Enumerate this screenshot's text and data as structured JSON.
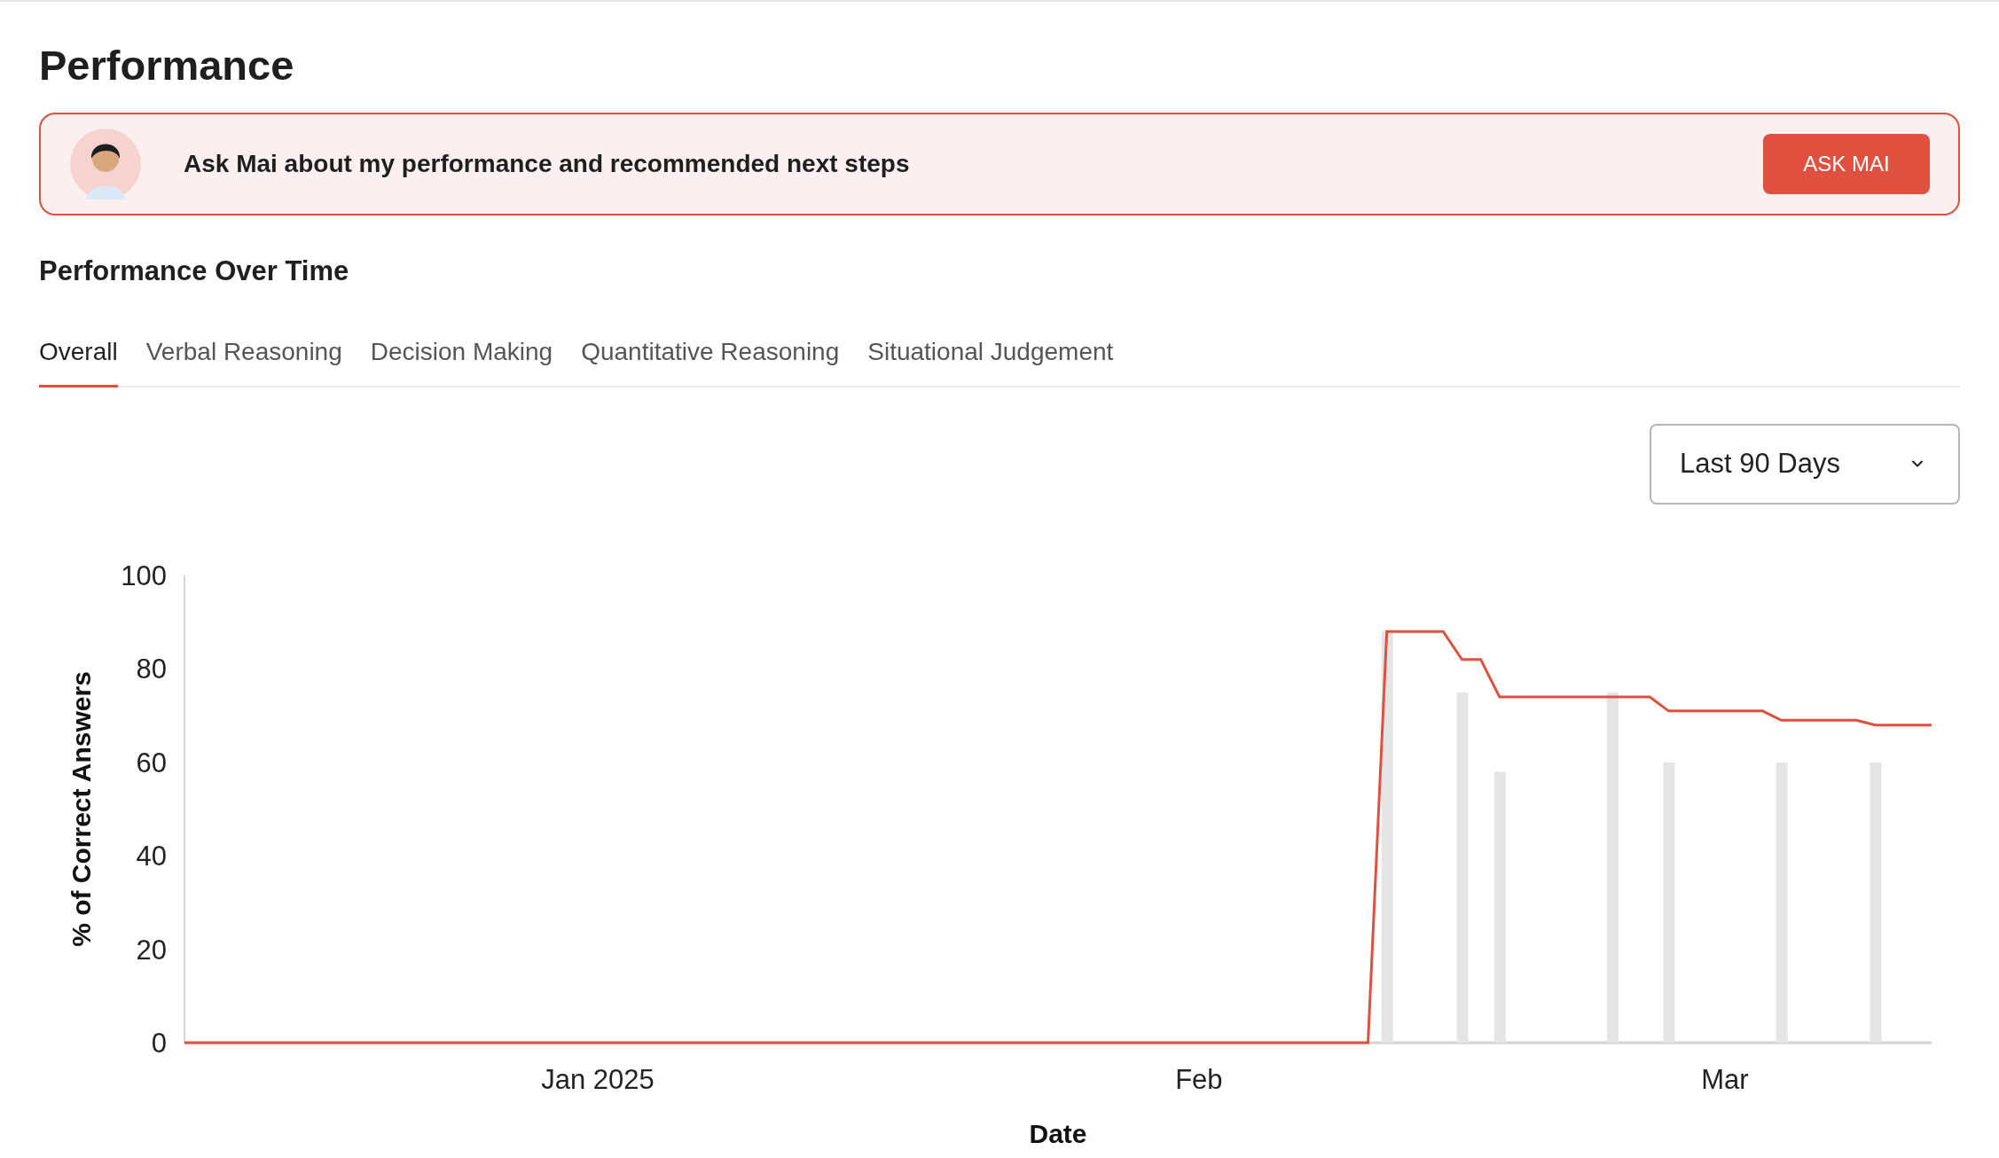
{
  "page": {
    "title": "Performance"
  },
  "banner": {
    "text": "Ask Mai about my performance and recommended next steps",
    "button": "ASK MAI"
  },
  "section": {
    "title": "Performance Over Time"
  },
  "tabs": [
    {
      "label": "Overall",
      "selected": true
    },
    {
      "label": "Verbal Reasoning",
      "selected": false
    },
    {
      "label": "Decision Making",
      "selected": false
    },
    {
      "label": "Quantitative Reasoning",
      "selected": false
    },
    {
      "label": "Situational Judgement",
      "selected": false
    }
  ],
  "range_select": {
    "value": "Last 90 Days"
  },
  "chart": {
    "chart_data": {
      "type": "line",
      "xlabel": "Date",
      "ylabel": "% of Correct Answers",
      "categories": [
        null,
        null,
        null,
        null,
        null,
        null,
        null,
        null,
        null,
        null,
        null,
        null,
        null,
        null,
        null,
        null,
        null,
        null,
        null,
        null,
        null,
        null,
        "Jan 2025",
        null,
        null,
        null,
        null,
        null,
        null,
        null,
        null,
        null,
        null,
        null,
        null,
        null,
        null,
        null,
        null,
        null,
        null,
        null,
        null,
        null,
        null,
        null,
        null,
        null,
        null,
        null,
        null,
        null,
        null,
        null,
        "Feb",
        null,
        null,
        null,
        null,
        null,
        null,
        null,
        null,
        null,
        null,
        null,
        null,
        null,
        null,
        null,
        null,
        null,
        null,
        null,
        null,
        null,
        null,
        null,
        null,
        null,
        null,
        null,
        "Mar",
        null,
        null,
        null,
        null,
        null,
        null,
        null,
        null,
        null,
        null,
        null
      ],
      "ylim": [
        0,
        100
      ],
      "yticks": [
        0,
        20,
        40,
        60,
        80,
        100
      ],
      "series": [
        {
          "type": "bar",
          "color": "#e5e5e5",
          "values": [
            null,
            null,
            null,
            null,
            null,
            null,
            null,
            null,
            null,
            null,
            null,
            null,
            null,
            null,
            null,
            null,
            null,
            null,
            null,
            null,
            null,
            null,
            null,
            null,
            null,
            null,
            null,
            null,
            null,
            null,
            null,
            null,
            null,
            null,
            null,
            null,
            null,
            null,
            null,
            null,
            null,
            null,
            null,
            null,
            null,
            null,
            null,
            null,
            null,
            null,
            null,
            null,
            null,
            null,
            null,
            null,
            null,
            null,
            null,
            null,
            null,
            null,
            null,
            null,
            88,
            null,
            null,
            null,
            75,
            null,
            58,
            null,
            null,
            null,
            null,
            null,
            75,
            null,
            null,
            60,
            null,
            null,
            null,
            null,
            null,
            60,
            null,
            null,
            null,
            null,
            60,
            null,
            null,
            null
          ]
        },
        {
          "color": "#e0503e",
          "values": [
            0,
            0,
            0,
            0,
            0,
            0,
            0,
            0,
            0,
            0,
            0,
            0,
            0,
            0,
            0,
            0,
            0,
            0,
            0,
            0,
            0,
            0,
            0,
            0,
            0,
            0,
            0,
            0,
            0,
            0,
            0,
            0,
            0,
            0,
            0,
            0,
            0,
            0,
            0,
            0,
            0,
            0,
            0,
            0,
            0,
            0,
            0,
            0,
            0,
            0,
            0,
            0,
            0,
            0,
            0,
            0,
            0,
            0,
            0,
            0,
            0,
            0,
            0,
            0,
            88,
            88,
            88,
            88,
            82,
            82,
            74,
            74,
            74,
            74,
            74,
            74,
            74,
            74,
            74,
            71,
            71,
            71,
            71,
            71,
            71,
            69,
            69,
            69,
            69,
            69,
            68,
            68,
            68,
            68
          ]
        }
      ]
    }
  }
}
